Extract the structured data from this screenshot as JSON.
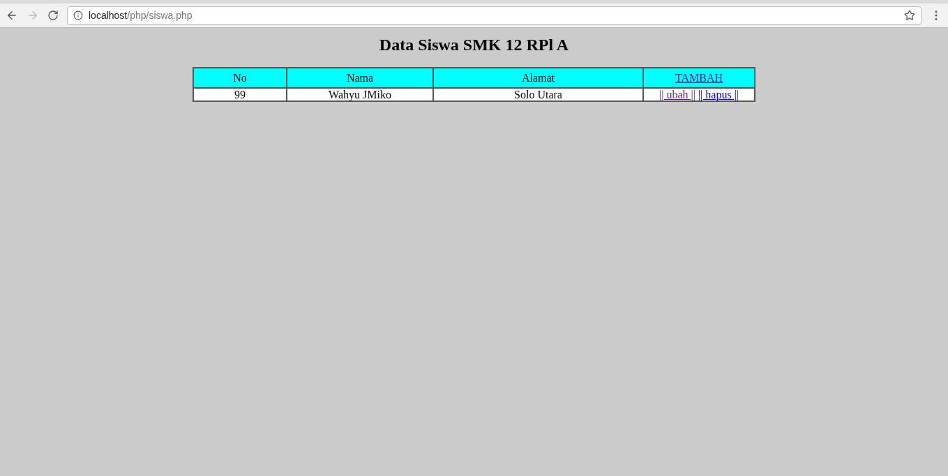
{
  "address_bar": {
    "host": "localhost",
    "path": "/php/siswa.php"
  },
  "page": {
    "title": "Data Siswa SMK 12 RPl A",
    "table": {
      "columns": [
        {
          "label": "No",
          "kind": "text"
        },
        {
          "label": "Nama",
          "kind": "text"
        },
        {
          "label": "Alamat",
          "kind": "text"
        },
        {
          "label": "TAMBAH",
          "kind": "link",
          "visited": true
        }
      ],
      "rows": [
        {
          "no": "99",
          "nama": "Wahyu JMiko",
          "alamat": "Solo Utara",
          "actions": [
            {
              "label": "|| ubah ||",
              "visited": true
            },
            {
              "label": "|| hapus ||",
              "visited": false
            }
          ]
        }
      ]
    }
  }
}
